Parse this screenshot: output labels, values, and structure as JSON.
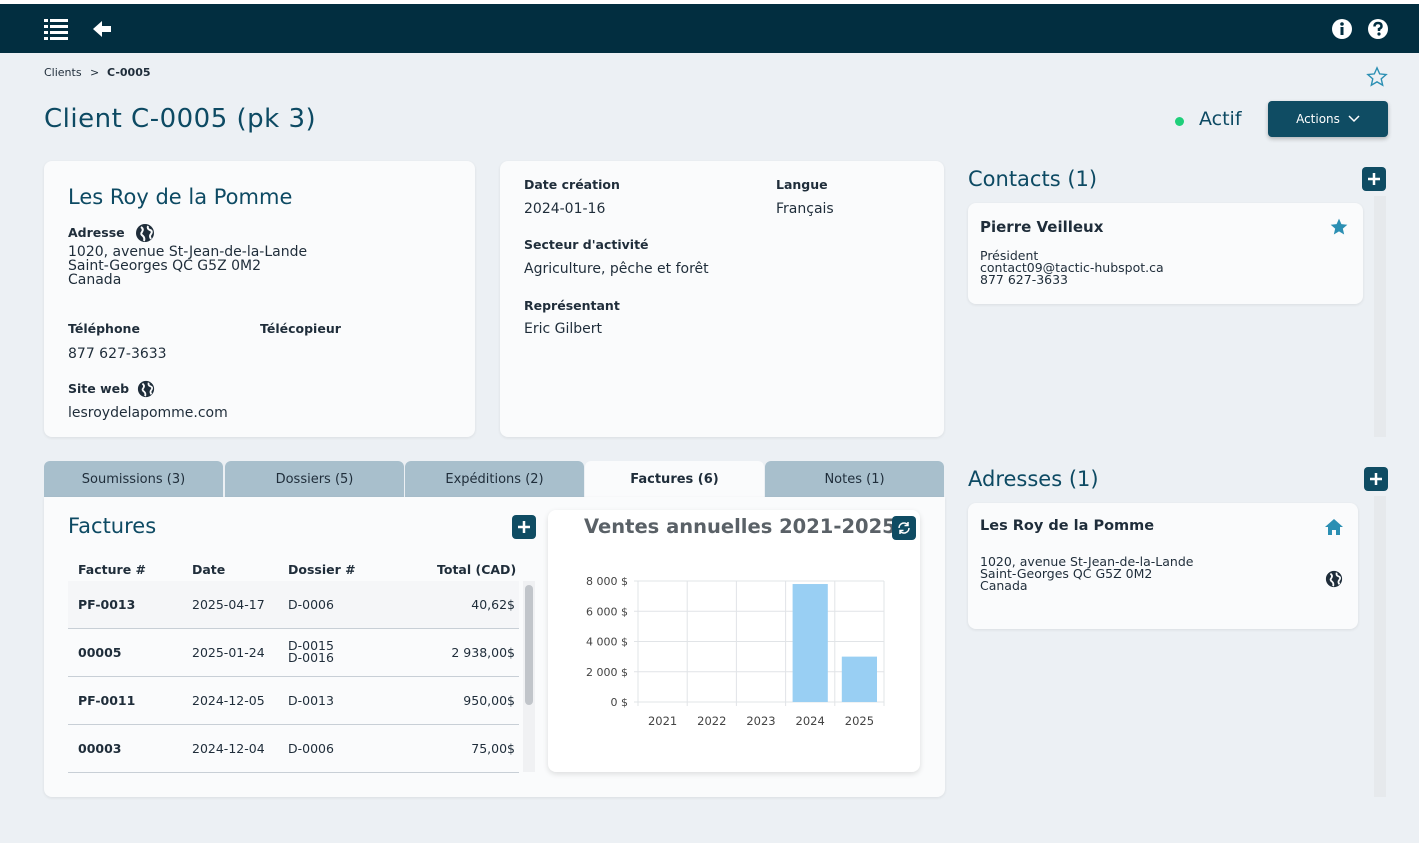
{
  "topbar": {
    "menu_icon": "list-icon",
    "back_icon": "arrow-left-icon",
    "info_icon": "info-icon",
    "help_icon": "help-icon"
  },
  "breadcrumb": {
    "parent": "Clients",
    "separator": ">",
    "current": "C-0005"
  },
  "page": {
    "title": "Client C-0005 (pk 3)",
    "status": "Actif",
    "status_color": "#1fcf7a",
    "actions_label": "Actions"
  },
  "client": {
    "name": "Les Roy de la Pomme",
    "address_label": "Adresse",
    "address_lines": [
      "1020, avenue St-Jean-de-la-Lande",
      "Saint-Georges QC  G5Z 0M2",
      "Canada"
    ],
    "phone_label": "Téléphone",
    "phone": "877 627-3633",
    "fax_label": "Télécopieur",
    "website_label": "Site web",
    "website": "lesroydelapomme.com"
  },
  "details": {
    "created_label": "Date création",
    "created": "2024-01-16",
    "language_label": "Langue",
    "language": "Français",
    "sector_label": "Secteur d'activité",
    "sector": "Agriculture, pêche et forêt",
    "rep_label": "Représentant",
    "rep": "Eric Gilbert"
  },
  "contacts": {
    "title": "Contacts (1)",
    "items": [
      {
        "name": "Pierre Veilleux",
        "role": "Président",
        "email": "contact09@tactic-hubspot.ca",
        "phone": "877 627-3633"
      }
    ]
  },
  "addresses": {
    "title": "Adresses (1)",
    "items": [
      {
        "name": "Les Roy de la Pomme",
        "lines": [
          "1020, avenue St-Jean-de-la-Lande",
          "Saint-Georges QC  G5Z 0M2",
          "Canada"
        ]
      }
    ]
  },
  "tabs": [
    {
      "label": "Soumissions (3)"
    },
    {
      "label": "Dossiers (5)"
    },
    {
      "label": "Expéditions (2)"
    },
    {
      "label": "Factures (6)"
    },
    {
      "label": "Notes (1)"
    }
  ],
  "invoices": {
    "title": "Factures",
    "columns": [
      "Facture #",
      "Date",
      "Dossier #",
      "Total (CAD)"
    ],
    "rows": [
      {
        "number": "PF-0013",
        "date": "2025-04-17",
        "dossiers": [
          "D-0006"
        ],
        "total": "40,62$"
      },
      {
        "number": "00005",
        "date": "2025-01-24",
        "dossiers": [
          "D-0015",
          "D-0016"
        ],
        "total": "2 938,00$"
      },
      {
        "number": "PF-0011",
        "date": "2024-12-05",
        "dossiers": [
          "D-0013"
        ],
        "total": "950,00$"
      },
      {
        "number": "00003",
        "date": "2024-12-04",
        "dossiers": [
          "D-0006"
        ],
        "total": "75,00$"
      }
    ]
  },
  "chart_data": {
    "type": "bar",
    "title": "Ventes annuelles 2021-2025",
    "categories": [
      "2021",
      "2022",
      "2023",
      "2024",
      "2025"
    ],
    "values": [
      0,
      0,
      0,
      7800,
      3000
    ],
    "ylim": [
      0,
      8000
    ],
    "yticks": [
      "0 $",
      "2 000 $",
      "4 000 $",
      "6 000 $",
      "8 000 $"
    ],
    "ytick_values": [
      0,
      2000,
      4000,
      6000,
      8000
    ],
    "bar_color": "#99cff3",
    "grid": true,
    "xlabel": "",
    "ylabel": ""
  }
}
